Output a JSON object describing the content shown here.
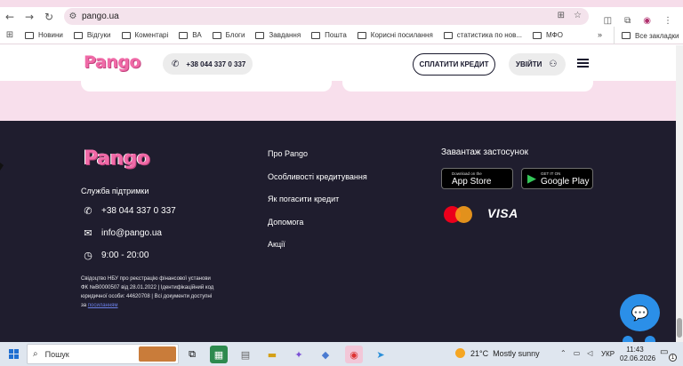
{
  "browser": {
    "url": "pango.ua",
    "nav_icons": [
      "back-icon",
      "forward-icon",
      "reload-icon"
    ],
    "bookmarks": [
      "Новини",
      "Відгуки",
      "Коментарі",
      "ВА",
      "Блоги",
      "Завдання",
      "Пошта",
      "Корисні посилання",
      "статистика по нов...",
      "МФО"
    ],
    "more_label": "»",
    "all_bookmarks": "Все закладки"
  },
  "header": {
    "logo": "Pango",
    "phone": "+38 044 337 0 337",
    "pay_button": "СПЛАТИТИ КРЕДИТ",
    "login_button": "УВІЙТИ"
  },
  "footer": {
    "logo": "Pango",
    "support_title": "Служба підтримки",
    "phone": "+38 044 337 0 337",
    "email": "info@pango.ua",
    "hours": "9:00 - 20:00",
    "legal_text": "Свідоцтво НБУ про реєстрацію фінансової установи ФК №В0000507 від 28.01.2022 | Ідентифікаційний код юридичної особи: 44620708 | Всі документи доступні за",
    "legal_link": "посиланням",
    "links": [
      "Про Pango",
      "Особливості кредитування",
      "Як погасити кредит",
      "Допомога",
      "Акції"
    ],
    "apps_title": "Завантаж застосунок",
    "app_store": {
      "small": "Download on the",
      "big": "App Store"
    },
    "google_play": {
      "small": "GET IT ON",
      "big": "Google Play"
    },
    "visa": "VISA"
  },
  "taskbar": {
    "search_placeholder": "Пошук",
    "weather_temp": "21°C",
    "weather_desc": "Mostly sunny",
    "language": "УКР",
    "time": "11:43",
    "date": "02.06.2026",
    "notifications": "1"
  },
  "colors": {
    "brand_pink": "#f06aa7",
    "footer_bg": "#1f1d2e",
    "chat_blue": "#2b8fe8"
  }
}
